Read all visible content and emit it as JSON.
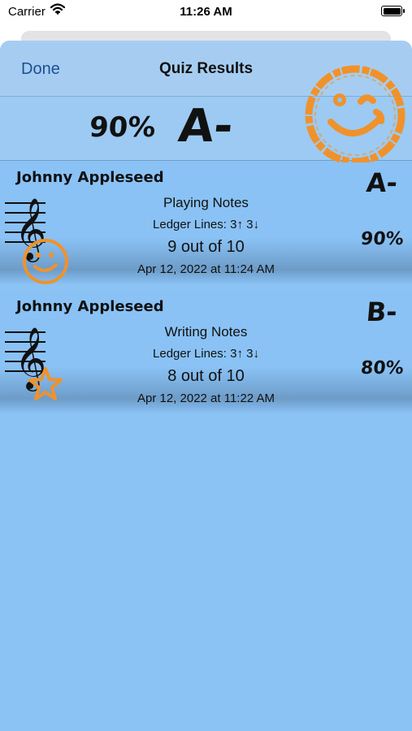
{
  "status_bar": {
    "carrier": "Carrier",
    "time": "11:26 AM"
  },
  "nav": {
    "done_label": "Done",
    "title": "Quiz Results"
  },
  "summary": {
    "percent": "90%",
    "grade": "A-"
  },
  "results": [
    {
      "student": "Johnny Appleseed",
      "quiz": "Playing Notes",
      "ledger": "Ledger Lines: 3↑ 3↓",
      "score": "9 out of 10",
      "date": "Apr 12, 2022 at 11:24 AM",
      "grade": "A-",
      "percent": "90%",
      "badge": "smiley-icon"
    },
    {
      "student": "Johnny Appleseed",
      "quiz": "Writing Notes",
      "ledger": "Ledger Lines: 3↑ 3↓",
      "score": "8 out of 10",
      "date": "Apr 12, 2022 at 11:22 AM",
      "grade": "B-",
      "percent": "80%",
      "badge": "star-icon"
    }
  ],
  "colors": {
    "background": "#8bc3f4",
    "accent": "#f0922b",
    "link": "#1d4f91"
  }
}
